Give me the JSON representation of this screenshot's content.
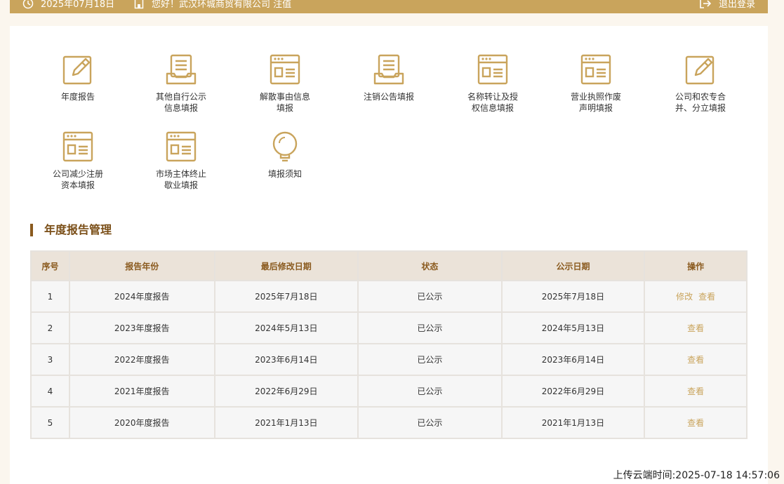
{
  "header": {
    "date": "2025年07月18日",
    "greeting": "您好！武汉环城商贸有限公司 注值",
    "logout_label": "退出登录"
  },
  "tiles": [
    {
      "label": "年度报告",
      "icon": "edit-icon"
    },
    {
      "label": "其他自行公示\n信息填报",
      "icon": "inbox-icon"
    },
    {
      "label": "解散事由信息\n填报",
      "icon": "window-icon"
    },
    {
      "label": "注销公告填报",
      "icon": "inbox-icon"
    },
    {
      "label": "名称转让及授\n权信息填报",
      "icon": "window-icon"
    },
    {
      "label": "营业执照作废\n声明填报",
      "icon": "window-icon"
    },
    {
      "label": "公司和农专合\n并、分立填报",
      "icon": "edit-icon"
    },
    {
      "label": "公司减少注册\n资本填报",
      "icon": "window-icon"
    },
    {
      "label": "市场主体终止\n歇业填报",
      "icon": "window-icon"
    },
    {
      "label": "填报须知",
      "icon": "lightbulb-icon"
    }
  ],
  "section": {
    "title": "年度报告管理"
  },
  "table": {
    "headers": [
      "序号",
      "报告年份",
      "最后修改日期",
      "状态",
      "公示日期",
      "操作"
    ],
    "rows": [
      {
        "no": "1",
        "year": "2024年度报告",
        "modified": "2025年7月18日",
        "status": "已公示",
        "published": "2025年7月18日",
        "edit": "修改",
        "view": "查看"
      },
      {
        "no": "2",
        "year": "2023年度报告",
        "modified": "2024年5月13日",
        "status": "已公示",
        "published": "2024年5月13日",
        "view": "查看"
      },
      {
        "no": "3",
        "year": "2022年度报告",
        "modified": "2023年6月14日",
        "status": "已公示",
        "published": "2023年6月14日",
        "view": "查看"
      },
      {
        "no": "4",
        "year": "2021年度报告",
        "modified": "2022年6月29日",
        "status": "已公示",
        "published": "2022年6月29日",
        "view": "查看"
      },
      {
        "no": "5",
        "year": "2020年度报告",
        "modified": "2021年1月13日",
        "status": "已公示",
        "published": "2021年1月13日",
        "view": "查看"
      }
    ]
  },
  "footer": {
    "upload_time": "上传云端时间:2025-07-18 14:57:06"
  },
  "colors": {
    "accent": "#c9a45c",
    "title": "#7a4e17",
    "header_bg": "#ebe3d9"
  }
}
